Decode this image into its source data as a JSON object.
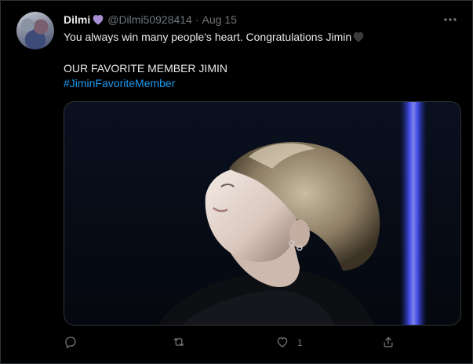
{
  "tweet": {
    "author_name": "Dilmi",
    "author_handle": "@Dilmi50928414",
    "separator": "·",
    "date": "Aug 15",
    "line1": "You always win many people's heart. Congratulations Jimin",
    "line2": "OUR FAVORITE MEMBER JIMIN",
    "hashtag": "#JiminFavoriteMember",
    "like_count": "1"
  },
  "icons": {
    "name_emoji": "purple-heart-icon",
    "text_emoji": "black-heart-icon",
    "more": "more-icon",
    "reply": "reply-icon",
    "retweet": "retweet-icon",
    "like": "like-icon",
    "share": "share-icon"
  },
  "colors": {
    "background": "#000000",
    "text": "#e7e9ea",
    "muted": "#71767b",
    "link": "#1d9bf0",
    "purple_heart": "#aa8ed6"
  }
}
